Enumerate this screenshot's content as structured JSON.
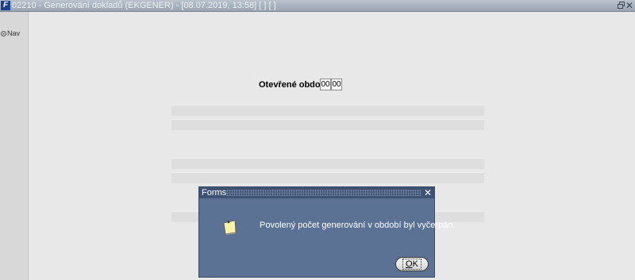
{
  "window": {
    "title": "02210 - Generování dokladů (EKGENER) - [08.07.2019, 13:58]  [ ]  [ ]",
    "app_icon": "F"
  },
  "leftpane": {
    "nav_label": "Nav"
  },
  "form": {
    "period_label": "Otevřené období",
    "period_values": [
      "00",
      "00"
    ]
  },
  "dialog": {
    "title": "Forms",
    "close_glyph": "✕",
    "message": "Povolený počet generování v období byl vyčerpán.",
    "ok_label": "OK",
    "icons": [
      "note-icon"
    ]
  },
  "colors": {
    "dialog_bg": "#5c7295",
    "dialog_titlebar": "#3f5273",
    "canvas": "#e8e8e8"
  }
}
